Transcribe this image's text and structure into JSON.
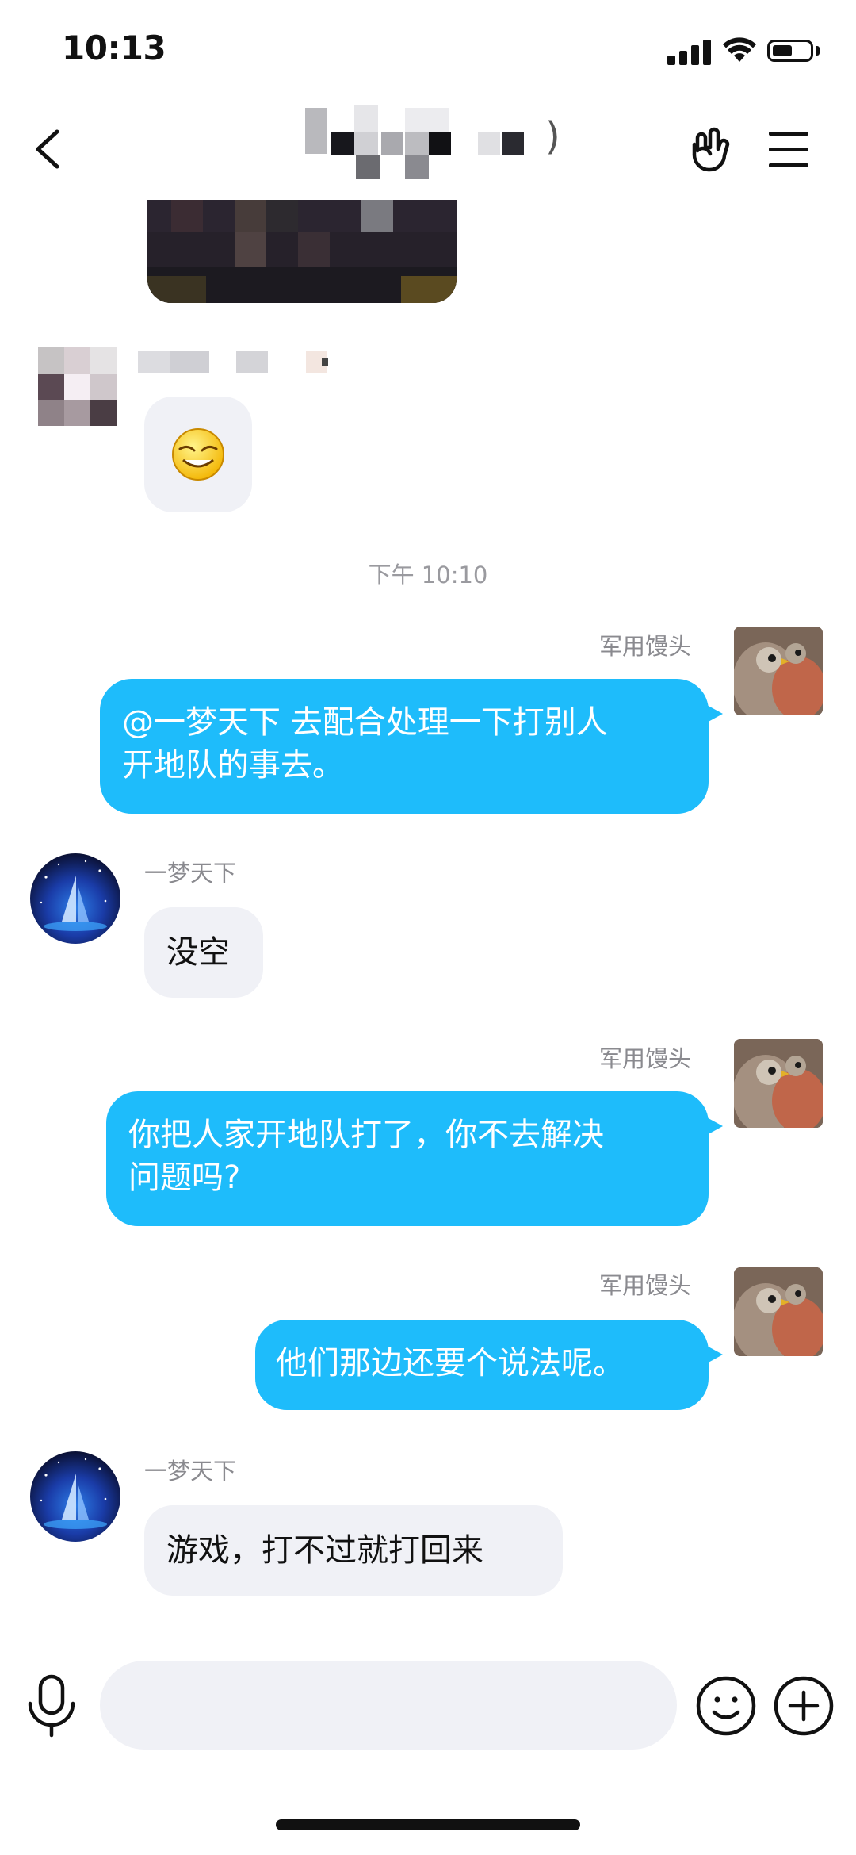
{
  "status_bar": {
    "time": "10:13",
    "battery_level": 0.55
  },
  "header": {
    "back_icon": "chevron-left-icon",
    "title_paren": ")",
    "action_icon": "rock-hand-icon",
    "menu_icon": "hamburger-menu-icon"
  },
  "timestamp": "下午 10:10",
  "messages": [
    {
      "direction": "out",
      "sender": "军用馒头",
      "text_lines": [
        "@一梦天下 去配合处理一下打别人",
        "开地队的事去。"
      ]
    },
    {
      "direction": "in",
      "sender": "一梦天下",
      "text": "没空"
    },
    {
      "direction": "out",
      "sender": "军用馒头",
      "text_lines": [
        "你把人家开地队打了，你不去解决",
        "问题吗?"
      ]
    },
    {
      "direction": "out",
      "sender": "军用馒头",
      "text": "他们那边还要个说法呢。"
    },
    {
      "direction": "in",
      "sender": "一梦天下",
      "text": "游戏，打不过就打回来"
    }
  ],
  "input_bar": {
    "voice_icon": "microphone-icon",
    "emoji_icon": "smiley-icon",
    "plus_icon": "plus-circle-icon"
  },
  "colors": {
    "outgoing_bubble": "#1ebcfb",
    "incoming_bubble": "#f0f1f6"
  }
}
